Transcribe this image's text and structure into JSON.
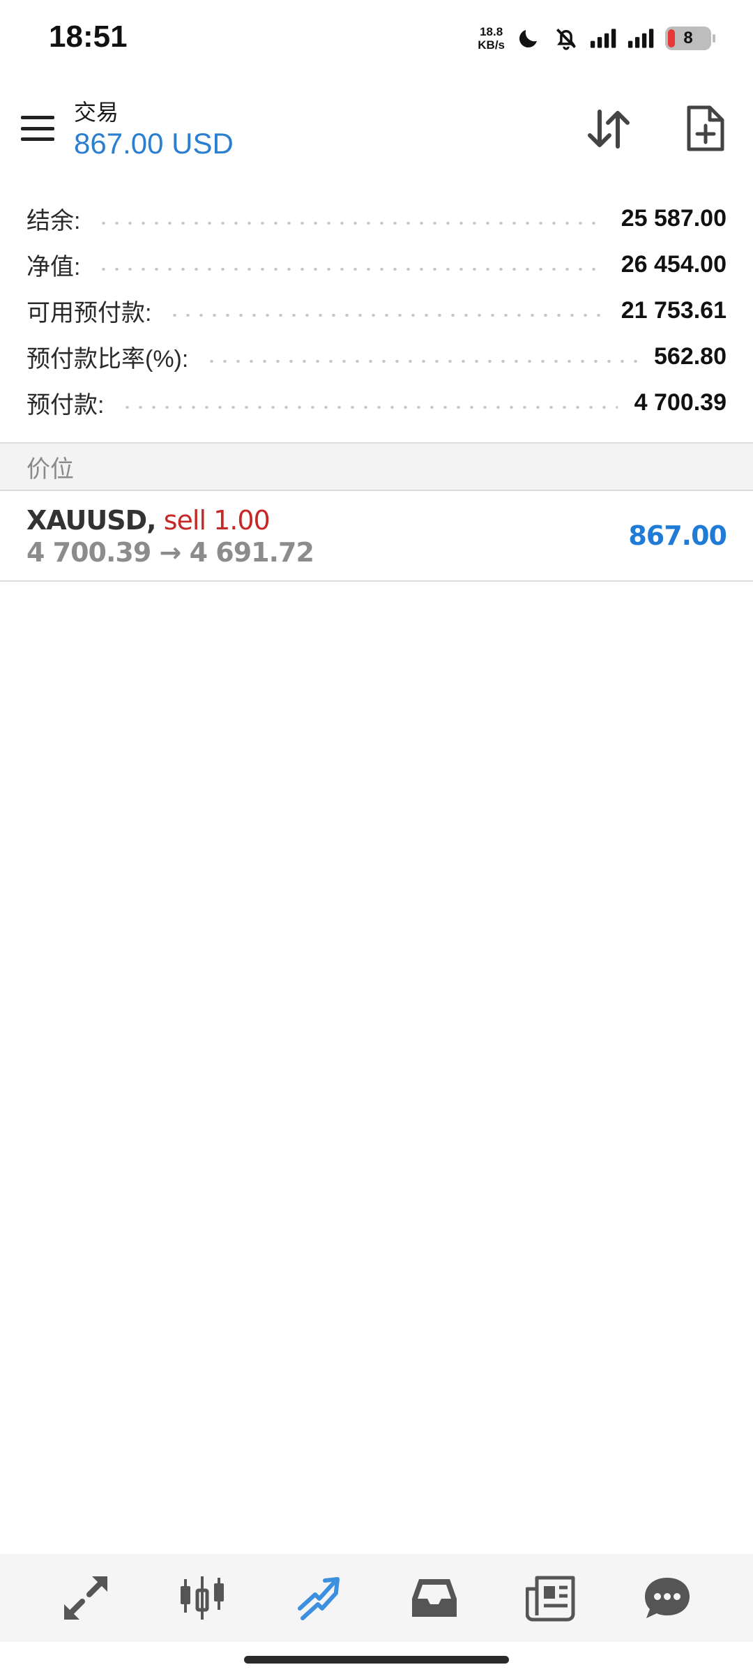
{
  "status_bar": {
    "time": "18:51",
    "net_speed_value": "18.8",
    "net_speed_unit": "KB/s",
    "battery_level": "8",
    "icons": [
      "moon-icon",
      "bell-off-icon",
      "signal-icon",
      "signal-icon"
    ]
  },
  "header": {
    "title": "交易",
    "profit": "867.00 USD",
    "profit_color": "#2b7fd0"
  },
  "summary": {
    "rows": [
      {
        "label": "结余:",
        "value": "25 587.00"
      },
      {
        "label": "净值:",
        "value": "26 454.00"
      },
      {
        "label": "可用预付款:",
        "value": "21 753.61"
      },
      {
        "label": "预付款比率(%):",
        "value": "562.80"
      },
      {
        "label": "预付款:",
        "value": "4 700.39"
      }
    ]
  },
  "section": {
    "title": "价位"
  },
  "positions": [
    {
      "symbol": "XAUUSD",
      "separator": ",",
      "side": "sell 1.00",
      "prices": "4 700.39 → 4 691.72",
      "profit": "867.00"
    }
  ],
  "colors": {
    "accent_blue": "#1f7bd6",
    "sell_red": "#c62828"
  },
  "bottom_nav": {
    "items": [
      "quotes-icon",
      "chart-icon",
      "trade-icon",
      "history-icon",
      "news-icon",
      "messages-icon"
    ],
    "active": "trade-icon"
  }
}
